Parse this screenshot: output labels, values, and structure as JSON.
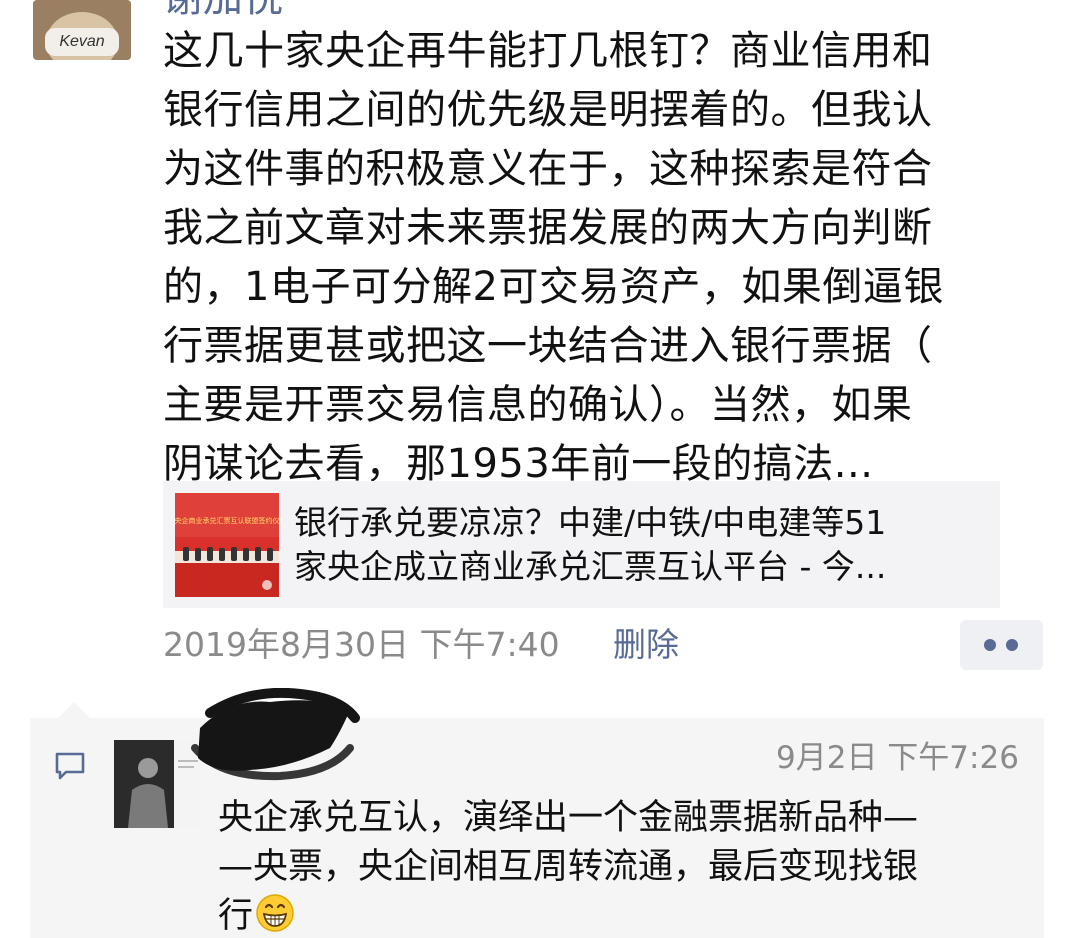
{
  "post": {
    "author_name": "谢加悦",
    "lines": [
      "这几十家央企再牛能打几根钉？商业信用和",
      "银行信用之间的优先级是明摆着的。但我认",
      "为这件事的积极意义在于，这种探索是符合",
      "我之前文章对未来票据发展的两大方向判断",
      "的，1电子可分解2可交易资产，如果倒逼银",
      "行票据更甚或把这一块结合进入银行票据（",
      "主要是开票交易信息的确认）。当然，如果",
      "阴谋论去看，那1953年前一段的搞法..."
    ],
    "link": {
      "title_line1": "银行承兑要凉凉？中建/中铁/中电建等51",
      "title_line2": "家央企成立商业承兑汇票互认平台 - 今...",
      "thumbnail_caption": "央企商业承兑汇票互认联盟签约仪"
    },
    "timestamp": "2019年8月30日 下午7:40",
    "delete_label": "删除"
  },
  "comment": {
    "time": "9月2日 下午7:26",
    "lines": [
      "央企承兑互认，演绎出一个金融票据新品种—",
      "—央票，央企间相互周转流通，最后变现找银",
      "行"
    ]
  },
  "colors": {
    "link_blue": "#576b95",
    "meta_gray": "#8a8a8a",
    "card_bg": "#f3f3f5",
    "comment_bg": "#f5f5f6",
    "banner_red": "#d9302c"
  },
  "icons": {
    "more": "more-dots-icon",
    "comment": "comment-bubble-icon",
    "emoji": "grin-emoji-icon"
  }
}
